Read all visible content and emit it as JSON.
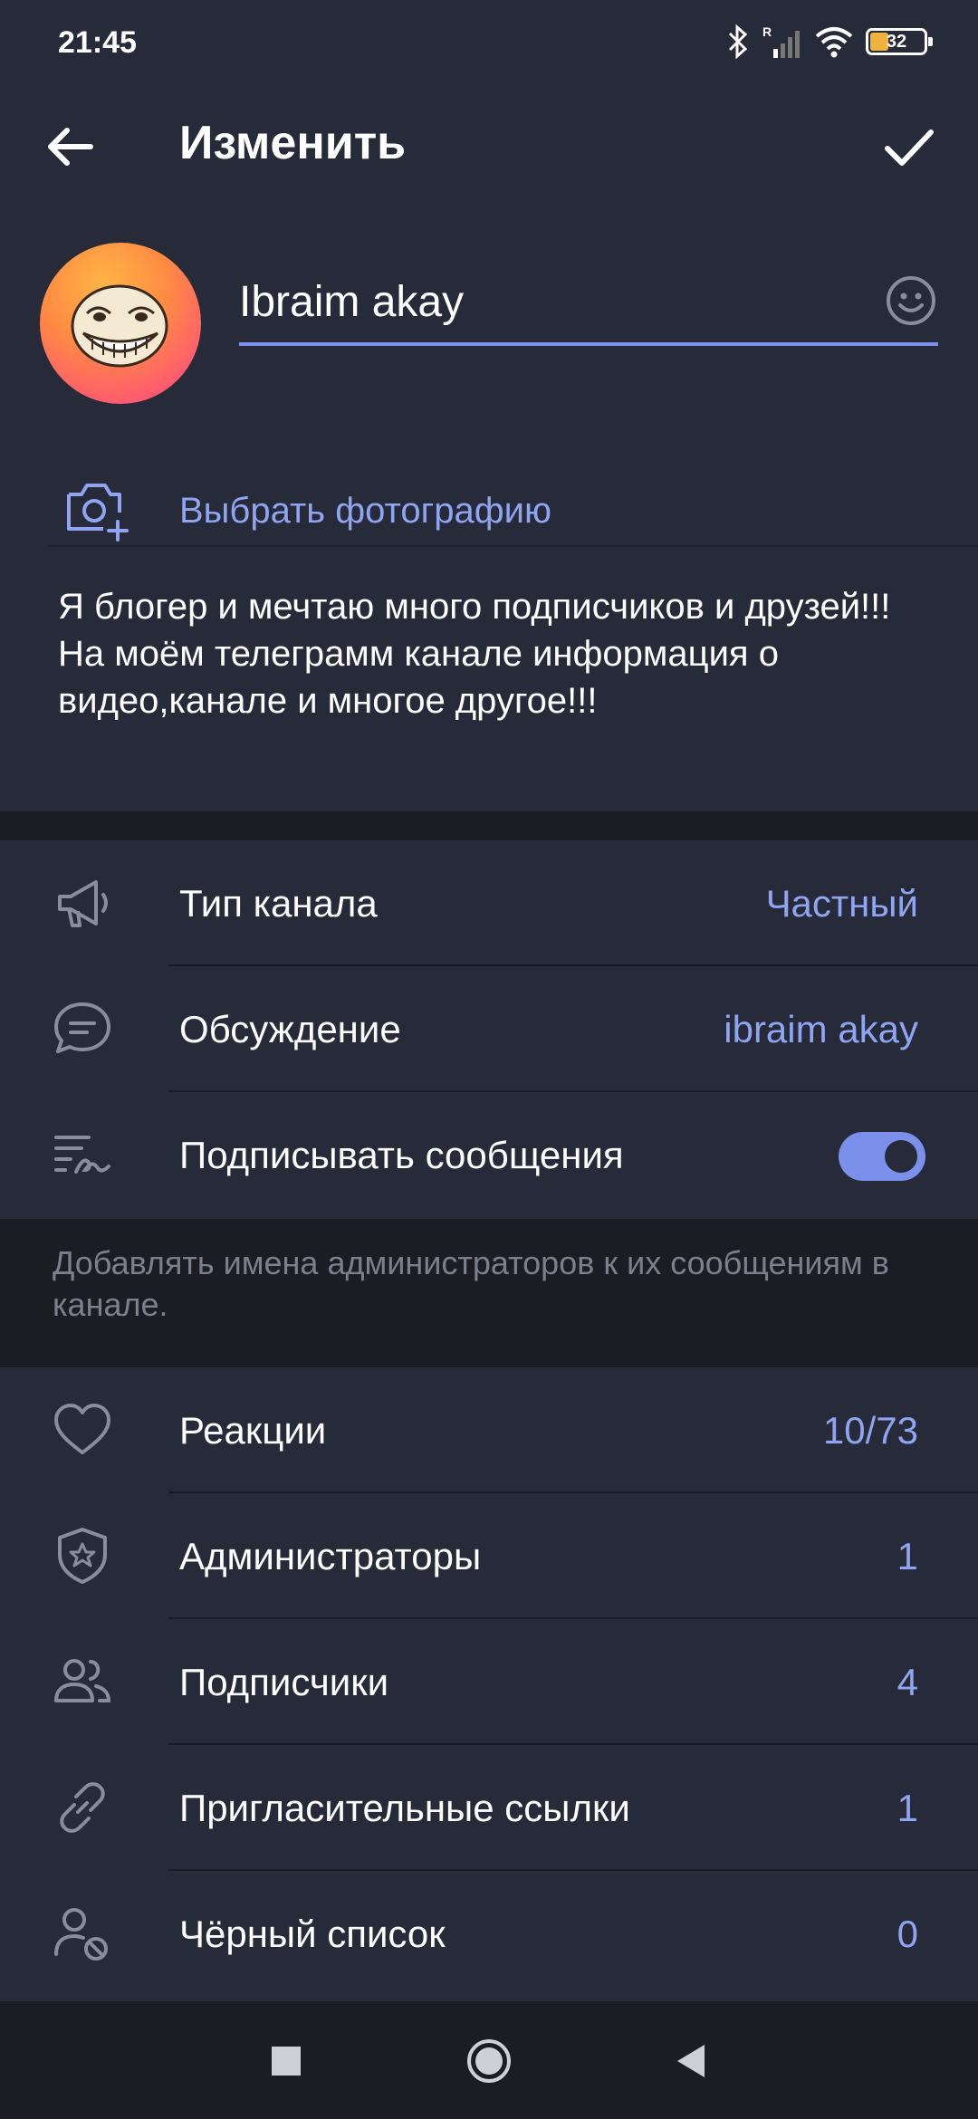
{
  "status_bar": {
    "time": "21:45",
    "battery": "32",
    "icons": [
      "bluetooth-icon",
      "signal-icon",
      "wifi-icon",
      "battery-icon"
    ]
  },
  "app_bar": {
    "title": "Изменить",
    "back_icon": "arrow-left-icon",
    "done_icon": "check-icon"
  },
  "profile": {
    "name": "Ibraim akay",
    "choose_photo": "Выбрать фотографию",
    "bio": "Я блогер и мечтаю много подписчиков и друзей!!! На моём телеграмм канале информация о видео,канале и многое другое!!!"
  },
  "settings": {
    "channel_type": {
      "label": "Тип канала",
      "value": "Частный"
    },
    "discussion": {
      "label": "Обсуждение",
      "value": "ibraim akay"
    },
    "sign_messages": {
      "label": "Подписывать сообщения",
      "enabled": true
    },
    "sign_hint": "Добавлять имена администраторов к их сообщениям в канале."
  },
  "management": {
    "reactions": {
      "label": "Реакции",
      "value": "10/73"
    },
    "admins": {
      "label": "Администраторы",
      "value": "1"
    },
    "subscribers": {
      "label": "Подписчики",
      "value": "4"
    },
    "invite_links": {
      "label": "Пригласительные ссылки",
      "value": "1"
    },
    "blacklist": {
      "label": "Чёрный список",
      "value": "0"
    }
  },
  "colors": {
    "accent": "#7a90ea",
    "link_text": "#8fa5f2",
    "surface": "#272a38",
    "background": "#1b1c24"
  }
}
